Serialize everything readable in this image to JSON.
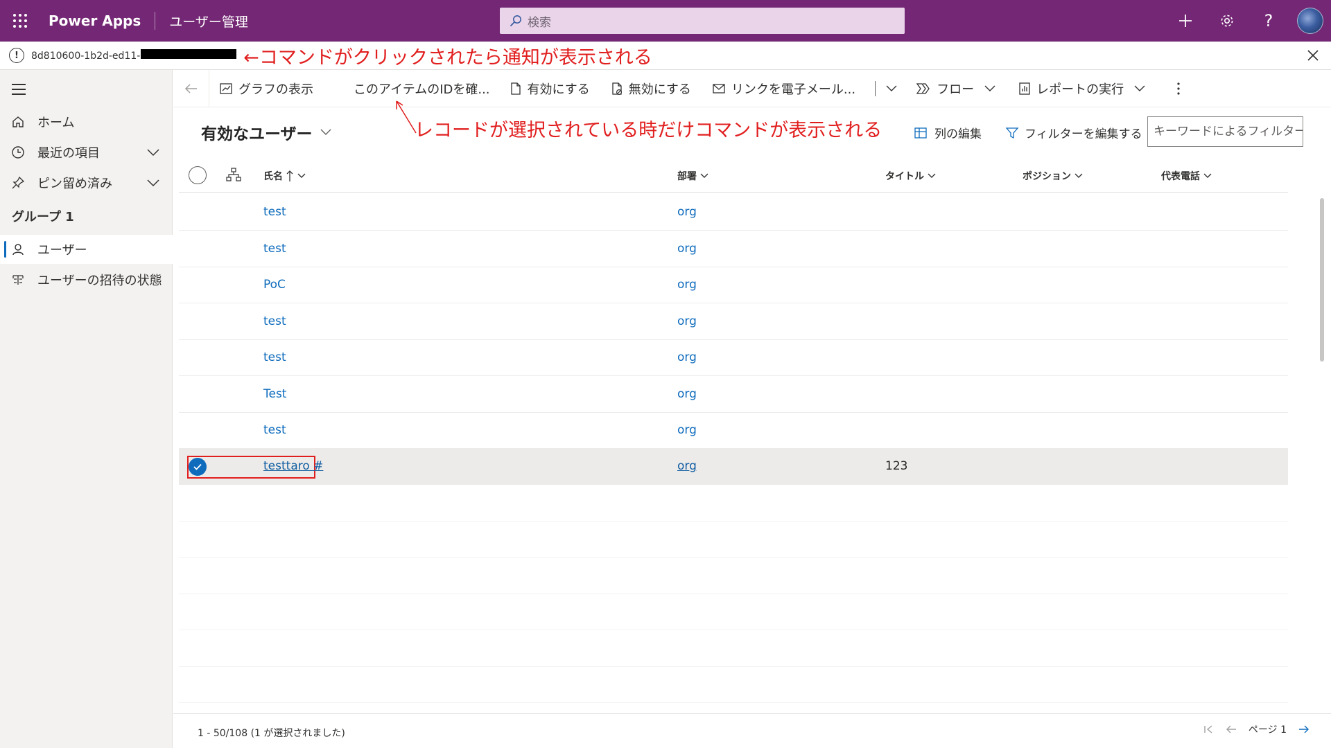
{
  "topbar": {
    "app_name": "Power Apps",
    "env_name": "ユーザー管理",
    "search_placeholder": "検索",
    "brand_color": "#742774"
  },
  "notification": {
    "id_text": "8d810600-1b2d-ed11-",
    "annotation": "←コマンドがクリックされたら通知が表示される"
  },
  "sidebar": {
    "items": [
      {
        "label": "ホーム",
        "icon": "home-icon"
      },
      {
        "label": "最近の項目",
        "icon": "clock-icon"
      },
      {
        "label": "ピン留め済み",
        "icon": "pin-icon"
      }
    ],
    "group_title": "グループ 1",
    "group_items": [
      {
        "label": "ユーザー",
        "icon": "person-icon"
      },
      {
        "label": "ユーザーの招待の状態",
        "icon": "invite-status-icon"
      }
    ]
  },
  "commands": {
    "show_chart": "グラフの表示",
    "check_id": "このアイテムのIDを確...",
    "activate": "有効にする",
    "deactivate": "無効にする",
    "email_link": "リンクを電子メール...",
    "flow": "フロー",
    "run_report": "レポートの実行"
  },
  "annotation_commands": "レコードが選択されている時だけコマンドが表示される",
  "view": {
    "title": "有効なユーザー",
    "edit_columns": "列の編集",
    "edit_filters": "フィルターを編集する",
    "keyword_placeholder": "キーワードによるフィルター"
  },
  "grid": {
    "columns": [
      "氏名",
      "部署",
      "タイトル",
      "ポジション",
      "代表電話"
    ],
    "rows": [
      {
        "name": "test",
        "dept": "org",
        "title": "",
        "position": "",
        "phone": ""
      },
      {
        "name": "test",
        "dept": "org",
        "title": "",
        "position": "",
        "phone": ""
      },
      {
        "name": "PoC",
        "dept": "org",
        "title": "",
        "position": "",
        "phone": ""
      },
      {
        "name": "test",
        "dept": "org",
        "title": "",
        "position": "",
        "phone": ""
      },
      {
        "name": "test",
        "dept": "org",
        "title": "",
        "position": "",
        "phone": ""
      },
      {
        "name": "Test",
        "dept": "org",
        "title": "",
        "position": "",
        "phone": ""
      },
      {
        "name": "test",
        "dept": "org",
        "title": "",
        "position": "",
        "phone": ""
      },
      {
        "name": "testtaro #",
        "dept": "org",
        "title": "123",
        "position": "",
        "phone": "",
        "selected": true
      }
    ]
  },
  "footer": {
    "status": "1 - 50/108 (1 が選択されました)",
    "page_label": "ページ 1"
  }
}
